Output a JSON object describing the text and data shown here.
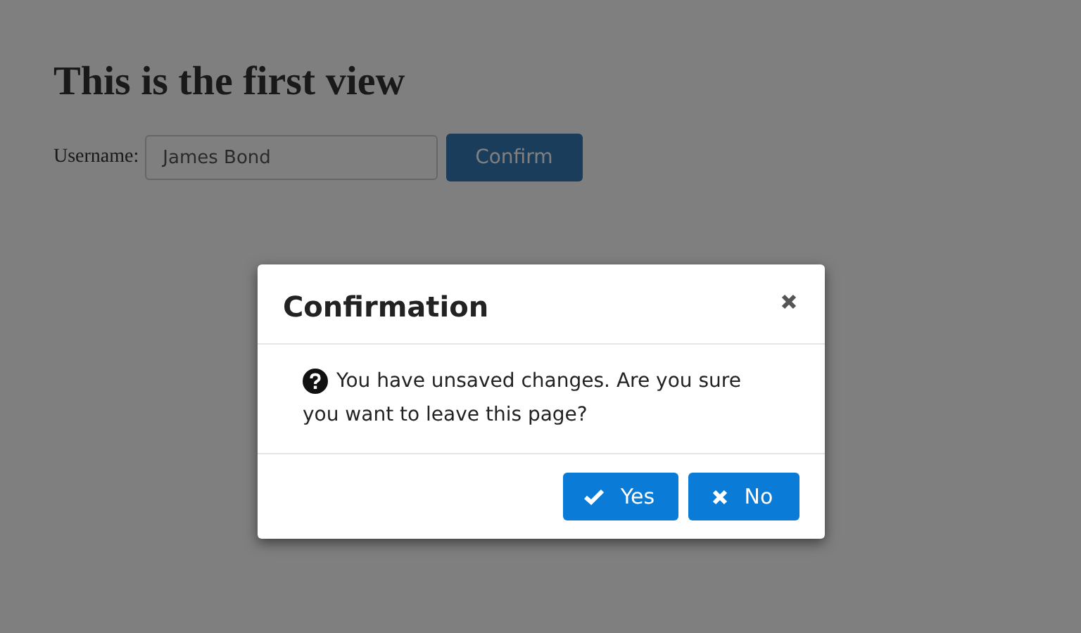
{
  "page": {
    "heading": "This is the first view",
    "username_label": "Username:",
    "username_value": "James Bond",
    "confirm_button": "Confirm"
  },
  "dialog": {
    "title": "Confirmation",
    "message": "You have unsaved changes. Are you sure you want to leave this page?",
    "buttons": [
      {
        "label": "Yes",
        "kind": "accept"
      },
      {
        "label": "No",
        "kind": "reject"
      }
    ]
  }
}
